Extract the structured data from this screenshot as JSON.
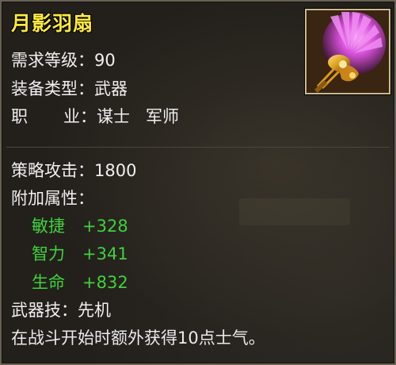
{
  "item": {
    "name": "月影羽扇",
    "icon": "feather-fan-weapon-icon",
    "name_color": "#ffea3c"
  },
  "stats": {
    "level_label": "需求等级：",
    "level_value": "90",
    "type_label": "装备类型：",
    "type_value": "武器",
    "job_label_a": "职",
    "job_label_b": "业：",
    "job_value_1": "谋士",
    "job_value_2": "军师",
    "attack_label": "策略攻击：",
    "attack_value": "1800",
    "extra_label": "附加属性："
  },
  "bonuses": [
    {
      "label": "敏捷",
      "value": "+328"
    },
    {
      "label": "智力",
      "value": "+341"
    },
    {
      "label": "生命",
      "value": "+832"
    }
  ],
  "skill": {
    "label": "武器技：",
    "value": "先机",
    "description": "在战斗开始时额外获得10点士气。"
  },
  "colors": {
    "bonus": "#3fd23a",
    "text": "#f0f0f0",
    "background": "#23201c",
    "border": "#6a6152"
  }
}
